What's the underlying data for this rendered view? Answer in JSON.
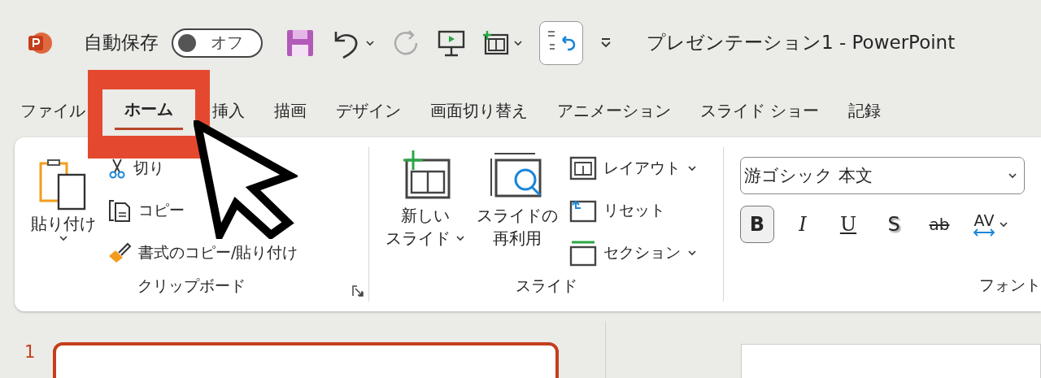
{
  "title_bar": {
    "autosave_label": "自動保存",
    "autosave_toggle": {
      "label": "オフ",
      "on": false
    },
    "title": "プレゼンテーション1  -  PowerPoint"
  },
  "tabs": [
    {
      "label": "ファイル",
      "selected": false
    },
    {
      "label": "ホーム",
      "selected": true
    },
    {
      "label": "挿入",
      "selected": false
    },
    {
      "label": "描画",
      "selected": false
    },
    {
      "label": "デザイン",
      "selected": false
    },
    {
      "label": "画面切り替え",
      "selected": false
    },
    {
      "label": "アニメーション",
      "selected": false
    },
    {
      "label": "スライド ショー",
      "selected": false
    },
    {
      "label": "記録",
      "selected": false
    }
  ],
  "ribbon": {
    "clipboard": {
      "paste": "貼り付け",
      "cut": "切り",
      "copy": "コピー",
      "format_painter": "書式のコピー/貼り付け",
      "label": "クリップボード"
    },
    "slides": {
      "new_slide": [
        "新しい",
        "スライド"
      ],
      "reuse": [
        "スライドの",
        "再利用"
      ],
      "layout": "レイアウト",
      "reset": "リセット",
      "section": "セクション",
      "label": "スライド"
    },
    "font": {
      "font_name": "游ゴシック 本文",
      "buttons": [
        {
          "kind": "bold",
          "label": "B",
          "selected": true
        },
        {
          "kind": "italic",
          "label": "I",
          "selected": false
        },
        {
          "kind": "underline",
          "label": "U",
          "selected": false
        },
        {
          "kind": "shadow",
          "label": "S",
          "selected": false
        },
        {
          "kind": "strike",
          "label": "ab",
          "selected": false
        },
        {
          "kind": "spacing",
          "label": "AV",
          "selected": false
        }
      ],
      "label": "フォント"
    }
  },
  "slide_panel": {
    "thumbnails": [
      {
        "number": "1",
        "selected": true
      }
    ]
  }
}
